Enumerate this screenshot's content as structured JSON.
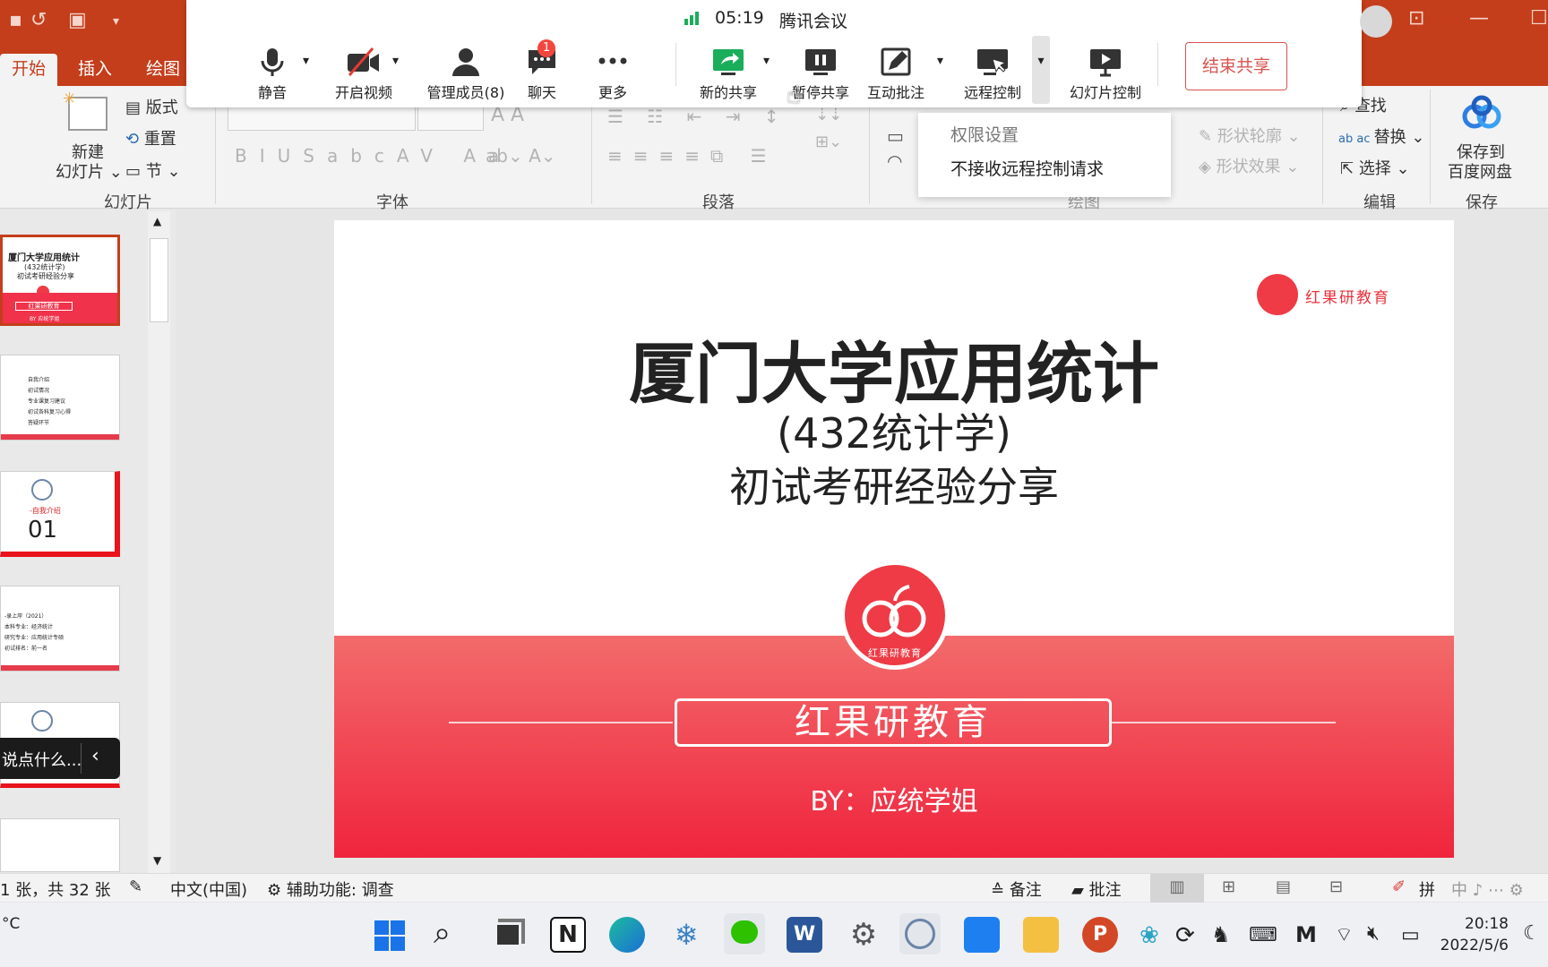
{
  "ppt": {
    "tabs": [
      "开始",
      "插入",
      "绘图"
    ],
    "ribbon": {
      "new_slide": "新建\n幻灯片",
      "new_slide_l1": "新建",
      "new_slide_l2": "幻灯片 ⌄",
      "layout": "版式",
      "reset": "重置",
      "section": "节 ⌄",
      "group_slides": "幻灯片",
      "group_font": "字体",
      "group_paragraph": "段落",
      "group_drawing": "绘图",
      "find": "查找",
      "replace": "替换",
      "select": "选择",
      "group_edit": "编辑",
      "shape_outline": "形状轮廓",
      "shape_effect": "形状效果",
      "save_baidu_l1": "保存到",
      "save_baidu_l2": "百度网盘",
      "group_save": "保存"
    },
    "thumb1": {
      "t1": "厦门大学应用统计",
      "t2": "(432统计学)",
      "t3": "初试考研经验分享",
      "brand": "红果研教育",
      "by": "BY 应统学姐"
    },
    "thumb2_items": [
      "自我介绍",
      "初试情况",
      "专业课复习建议",
      "初试各科复习心得",
      "答疑环节"
    ],
    "thumb3": {
      "label": "-自我介绍",
      "num": "01"
    },
    "thumb4_items": [
      "-录上岸（2021）",
      "本科专业：经济统计",
      "研究专业：应用统计专硕",
      "初试排名：前一名"
    ],
    "chat_hint": "说点什么...",
    "slide": {
      "title": "厦门大学应用统计",
      "subtitle1": "(432统计学)",
      "subtitle2": "初试考研经验分享",
      "brand": "红果研教育",
      "logo_text": "红果研教育",
      "corner_brand": "红果研教育",
      "byline": "BY：应统学姐"
    },
    "status": {
      "slide_count": "1 张，共 32 张",
      "language": "中文(中国)",
      "accessibility": "辅助功能: 调查",
      "notes": "备注",
      "comments": "批注"
    }
  },
  "meeting": {
    "signal_time": "05:19",
    "app_name": "腾讯会议",
    "buttons": [
      {
        "label": "静音"
      },
      {
        "label": "开启视频"
      },
      {
        "label": "管理成员(8)"
      },
      {
        "label": "聊天",
        "badge": "1"
      },
      {
        "label": "更多"
      },
      {
        "label": "新的共享"
      },
      {
        "label": "暂停共享"
      },
      {
        "label": "互动批注"
      },
      {
        "label": "远程控制"
      },
      {
        "label": "幻灯片控制"
      }
    ],
    "end_share": "结束共享",
    "dropdown": [
      "权限设置",
      "不接收远程控制请求"
    ],
    "accent": "#1aad5a",
    "end_color": "#d9534f"
  },
  "taskbar": {
    "weather": "°C",
    "clock_time": "20:18",
    "clock_date": "2022/5/6",
    "ime": "拼"
  }
}
